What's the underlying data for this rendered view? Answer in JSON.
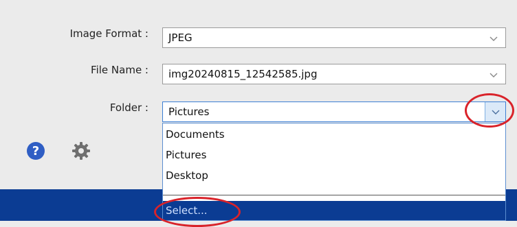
{
  "form": {
    "image_format": {
      "label": "Image Format :",
      "value": "JPEG"
    },
    "file_name": {
      "label": "File Name :",
      "value": "img20240815_12542585.jpg"
    },
    "folder": {
      "label": "Folder :",
      "value": "Pictures",
      "options": [
        "Documents",
        "Pictures",
        "Desktop"
      ],
      "select_option": "Select..."
    }
  },
  "icons": {
    "help": "help-icon",
    "settings": "gear-icon"
  },
  "colors": {
    "accent": "#0b3c93",
    "highlight": "#d9232a",
    "help_blue": "#2f5ec4"
  }
}
